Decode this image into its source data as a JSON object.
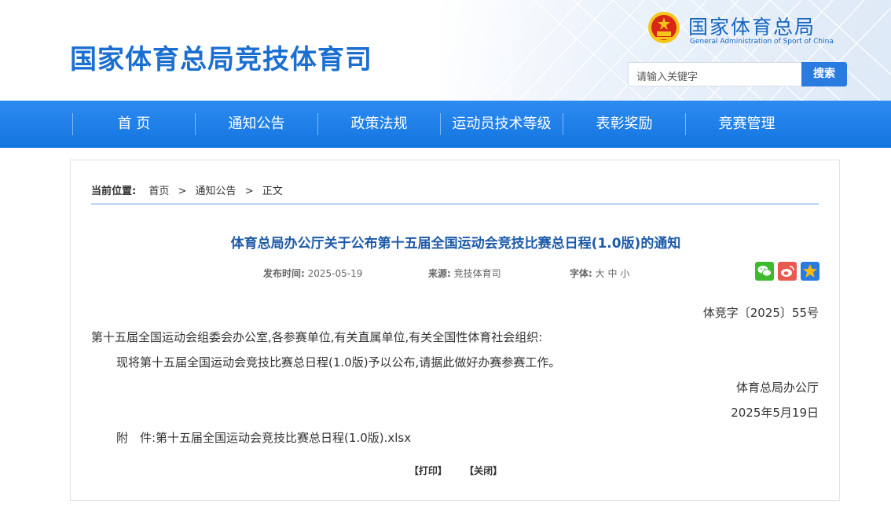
{
  "header": {
    "site_title": "国家体育总局竞技体育司",
    "brand_cn": "国家体育总局",
    "brand_en": "General Administration of Sport of China",
    "search_placeholder": "请输入关键字",
    "search_button": "搜索"
  },
  "nav": {
    "items": [
      "首 页",
      "通知公告",
      "政策法规",
      "运动员技术等级",
      "表彰奖励",
      "竞赛管理"
    ]
  },
  "breadcrumb": {
    "label": "当前位置:",
    "items": [
      "首页",
      "通知公告",
      "正文"
    ],
    "separator": ">"
  },
  "article": {
    "title": "体育总局办公厅关于公布第十五届全国运动会竞技比赛总日程(1.0版)的通知",
    "meta": {
      "date_label": "发布时间:",
      "date": "2025-05-19",
      "source_label": "来源:",
      "source": "竞技体育司",
      "font_label": "字体:",
      "font_options": [
        "大",
        "中",
        "小"
      ]
    },
    "doc_number": "体竞字〔2025〕55号",
    "salutation": "第十五届全国运动会组委会办公室,各参赛单位,有关直属单位,有关全国性体育社会组织:",
    "body": "现将第十五届全国运动会竞技比赛总日程(1.0版)予以公布,请据此做好办赛参赛工作。",
    "signature": "体育总局办公厅",
    "sign_date": "2025年5月19日",
    "attachment": "附　件:第十五届全国运动会竞技比赛总日程(1.0版).xlsx",
    "print_label": "【打印】",
    "close_label": "【关闭】"
  },
  "share_icons": [
    "wechat-icon",
    "weibo-icon",
    "favorite-star-icon"
  ],
  "colors": {
    "nav_blue": "#1b7de6",
    "title_blue": "#1c5aa8",
    "brand_blue": "#1565c0",
    "search_button": "#2a7be0",
    "wechat_green": "#3dba2d",
    "weibo_red": "#e85a4f",
    "star_yellow": "#f5b90f"
  }
}
